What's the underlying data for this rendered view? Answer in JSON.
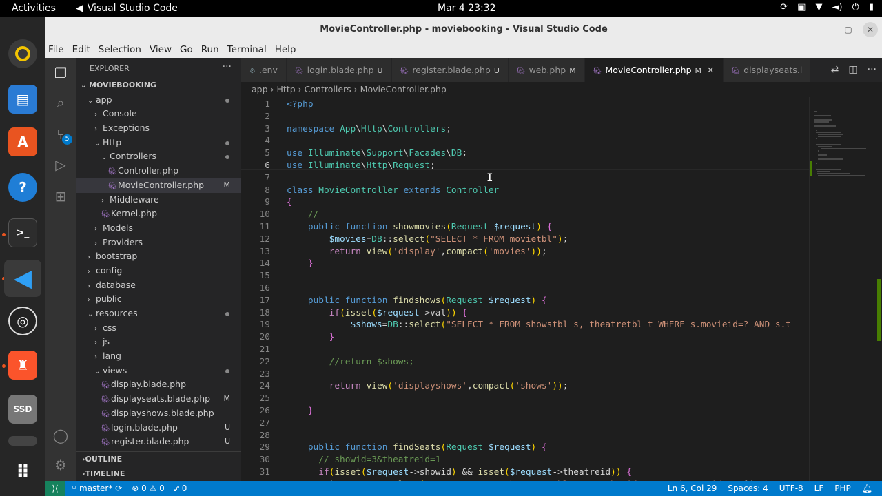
{
  "topbar": {
    "activities": "Activities",
    "app_name": "Visual Studio Code",
    "clock": "Mar 4  23:32"
  },
  "window": {
    "title": "MovieController.php - moviebooking - Visual Studio Code"
  },
  "menu": [
    "File",
    "Edit",
    "Selection",
    "View",
    "Go",
    "Run",
    "Terminal",
    "Help"
  ],
  "activity_badge": "5",
  "explorer": {
    "header": "EXPLORER",
    "root": "MOVIEBOOKING",
    "items": [
      {
        "label": "app",
        "indent": 1,
        "kind": "open",
        "mark": "dot"
      },
      {
        "label": "Console",
        "indent": 2,
        "kind": "closed",
        "mark": ""
      },
      {
        "label": "Exceptions",
        "indent": 2,
        "kind": "closed",
        "mark": ""
      },
      {
        "label": "Http",
        "indent": 2,
        "kind": "open",
        "mark": "dot"
      },
      {
        "label": "Controllers",
        "indent": 3,
        "kind": "open",
        "mark": "dot"
      },
      {
        "label": "Controller.php",
        "indent": 4,
        "kind": "php",
        "mark": ""
      },
      {
        "label": "MovieController.php",
        "indent": 4,
        "kind": "php",
        "mark": "M",
        "selected": true
      },
      {
        "label": "Middleware",
        "indent": 3,
        "kind": "closed",
        "mark": ""
      },
      {
        "label": "Kernel.php",
        "indent": 3,
        "kind": "php",
        "mark": ""
      },
      {
        "label": "Models",
        "indent": 2,
        "kind": "closed",
        "mark": ""
      },
      {
        "label": "Providers",
        "indent": 2,
        "kind": "closed",
        "mark": ""
      },
      {
        "label": "bootstrap",
        "indent": 1,
        "kind": "closed",
        "mark": ""
      },
      {
        "label": "config",
        "indent": 1,
        "kind": "closed",
        "mark": ""
      },
      {
        "label": "database",
        "indent": 1,
        "kind": "closed",
        "mark": ""
      },
      {
        "label": "public",
        "indent": 1,
        "kind": "closed",
        "mark": ""
      },
      {
        "label": "resources",
        "indent": 1,
        "kind": "open",
        "mark": "dot"
      },
      {
        "label": "css",
        "indent": 2,
        "kind": "closed",
        "mark": ""
      },
      {
        "label": "js",
        "indent": 2,
        "kind": "closed",
        "mark": ""
      },
      {
        "label": "lang",
        "indent": 2,
        "kind": "closed",
        "mark": ""
      },
      {
        "label": "views",
        "indent": 2,
        "kind": "open",
        "mark": "dot"
      },
      {
        "label": "display.blade.php",
        "indent": 3,
        "kind": "php",
        "mark": ""
      },
      {
        "label": "displayseats.blade.php",
        "indent": 3,
        "kind": "php",
        "mark": "M"
      },
      {
        "label": "displayshows.blade.php",
        "indent": 3,
        "kind": "php",
        "mark": ""
      },
      {
        "label": "login.blade.php",
        "indent": 3,
        "kind": "php",
        "mark": "U"
      },
      {
        "label": "register.blade.php",
        "indent": 3,
        "kind": "php",
        "mark": "U"
      }
    ],
    "outline": "OUTLINE",
    "timeline": "TIMELINE"
  },
  "tabs": [
    {
      "label": ".env",
      "mod": "",
      "icon": "gear"
    },
    {
      "label": "login.blade.php",
      "mod": "U",
      "icon": "php"
    },
    {
      "label": "register.blade.php",
      "mod": "U",
      "icon": "php"
    },
    {
      "label": "web.php",
      "mod": "M",
      "icon": "php"
    },
    {
      "label": "MovieController.php",
      "mod": "M",
      "icon": "php",
      "active": true
    },
    {
      "label": "displayseats.l",
      "mod": "",
      "icon": "php"
    }
  ],
  "breadcrumb": [
    "app",
    "Http",
    "Controllers",
    "MovieController.php"
  ],
  "code_lines": [
    "<?php",
    "",
    "namespace App\\Http\\Controllers;",
    "",
    "use Illuminate\\Support\\Facades\\DB;",
    "use Illuminate\\Http\\Request;",
    "",
    "class MovieController extends Controller",
    "{",
    "    //",
    "    public function showmovies(Request $request) {",
    "        $movies=DB::select(\"SELECT * FROM movietbl\");",
    "        return view('display',compact('movies'));",
    "    }",
    "",
    "",
    "    public function findshows(Request $request) {",
    "        if(isset($request->val)) {",
    "            $shows=DB::select(\"SELECT * FROM showstbl s, theatretbl t WHERE s.movieid=? AND s.t",
    "        }",
    "",
    "        //return $shows;",
    "",
    "        return view('displayshows',compact('shows'));",
    "",
    "    }",
    "",
    "",
    "    public function findSeats(Request $request) {",
    "      // showid=3&theatreid=1",
    "      if(isset($request->showid) && isset($request->theatreid)) {",
    "        $seats=DB::select(\"SELECT * FROM showseatstbl WHERE showid=? AND theatreid=?\",[$reques"
  ],
  "current_line": 6,
  "status": {
    "branch": "master*",
    "errors": "0",
    "warnings": "0",
    "ports": "0",
    "position": "Ln 6, Col 29",
    "spaces": "Spaces: 4",
    "encoding": "UTF-8",
    "eol": "LF",
    "language": "PHP"
  }
}
